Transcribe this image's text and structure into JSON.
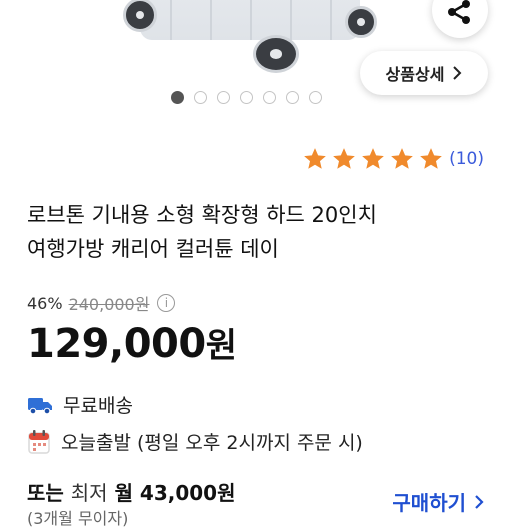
{
  "gallery": {
    "detail_button_label": "상품상세",
    "dot_count": 7,
    "active_dot_index": 0
  },
  "rating": {
    "stars": 5,
    "count_label": "(10)"
  },
  "product": {
    "title_line1": "로브톤 기내용 소형 확장형 하드 20인치",
    "title_line2": "여행가방 캐리어 컬러튠 데이",
    "discount_rate": "46%",
    "original_price": "240,000원",
    "price_number": "129,000",
    "price_unit": "원"
  },
  "shipping": {
    "free_shipping_label": "무료배송",
    "today_shipping_label": "오늘출발 (평일 오후 2시까지 주문 시)"
  },
  "installment": {
    "prefix": "또는",
    "light": "최저",
    "amount": "월 43,000원",
    "sub": "(3개월 무이자)",
    "buy_link_label": "구매하기"
  },
  "colors": {
    "accent_blue": "#1f4fd1",
    "star_orange": "#f08a2c",
    "rating_blue": "#3b5bdb",
    "truck_blue": "#2f6fd6",
    "calendar_red": "#e04a3a"
  }
}
